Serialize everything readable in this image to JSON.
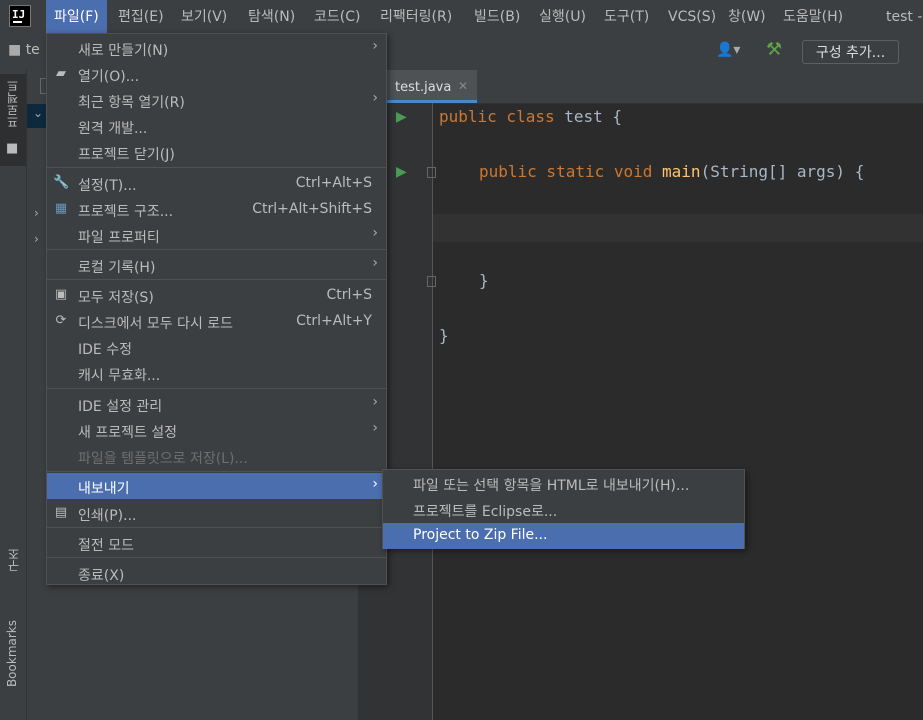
{
  "menubar": {
    "logo": "IJ",
    "items": [
      {
        "label": "파일(F)"
      },
      {
        "label": "편집(E)"
      },
      {
        "label": "보기(V)"
      },
      {
        "label": "탐색(N)"
      },
      {
        "label": "코드(C)"
      },
      {
        "label": "리팩터링(R)"
      },
      {
        "label": "빌드(B)"
      },
      {
        "label": "실행(U)"
      },
      {
        "label": "도구(T)"
      },
      {
        "label": "VCS(S)"
      },
      {
        "label": "창(W)"
      },
      {
        "label": "도움말(H)"
      }
    ],
    "window_title": "test -"
  },
  "toolbar": {
    "project_crumb": "te",
    "add_config_label": "구성 추가..."
  },
  "left_stripe": {
    "project_tab": "프로젝트",
    "structure_tab": "구조",
    "bookmarks_tab": "Bookmarks"
  },
  "editor": {
    "tab_label": "test.java",
    "code": {
      "line1_kw": "public class ",
      "line1_rest": "test {",
      "line3_kw": "public static void ",
      "line3_fn": "main",
      "line3_rest": "(String[] args) {",
      "line6": "}",
      "line8": "}"
    }
  },
  "file_menu": {
    "items": [
      {
        "label": "새로 만들기(N)",
        "submenu": true
      },
      {
        "label": "열기(O)...",
        "icon": "folder-open-icon"
      },
      {
        "label": "최근 항목 열기(R)",
        "submenu": true
      },
      {
        "label": "원격 개발..."
      },
      {
        "label": "프로젝트 닫기(J)"
      },
      {
        "label": "설정(T)...",
        "shortcut": "Ctrl+Alt+S",
        "icon": "wrench-icon"
      },
      {
        "label": "프로젝트 구조...",
        "shortcut": "Ctrl+Alt+Shift+S",
        "icon": "project-structure-icon"
      },
      {
        "label": "파일 프로퍼티",
        "submenu": true
      },
      {
        "label": "로컬 기록(H)",
        "submenu": true
      },
      {
        "label": "모두 저장(S)",
        "shortcut": "Ctrl+S",
        "icon": "save-icon"
      },
      {
        "label": "디스크에서 모두 다시 로드",
        "shortcut": "Ctrl+Alt+Y",
        "icon": "reload-icon"
      },
      {
        "label": "IDE 수정"
      },
      {
        "label": "캐시 무효화..."
      },
      {
        "label": "IDE 설정 관리",
        "submenu": true
      },
      {
        "label": "새 프로젝트 설정",
        "submenu": true
      },
      {
        "label": "파일을 템플릿으로 저장(L)...",
        "disabled": true
      },
      {
        "label": "내보내기",
        "submenu": true,
        "highlighted": true
      },
      {
        "label": "인쇄(P)...",
        "icon": "print-icon"
      },
      {
        "label": "절전 모드"
      },
      {
        "label": "종료(X)"
      }
    ]
  },
  "export_submenu": {
    "items": [
      {
        "label": "파일 또는 선택 항목을 HTML로 내보내기(H)..."
      },
      {
        "label": "프로젝트를 Eclipse로..."
      },
      {
        "label": "Project to Zip File...",
        "highlighted": true
      }
    ]
  },
  "colors": {
    "accent": "#4b6eaf",
    "background": "#2b2b2b",
    "panel": "#3c3f41",
    "keyword": "#cc7832",
    "function": "#ffc66d",
    "run_green": "#499c54"
  }
}
